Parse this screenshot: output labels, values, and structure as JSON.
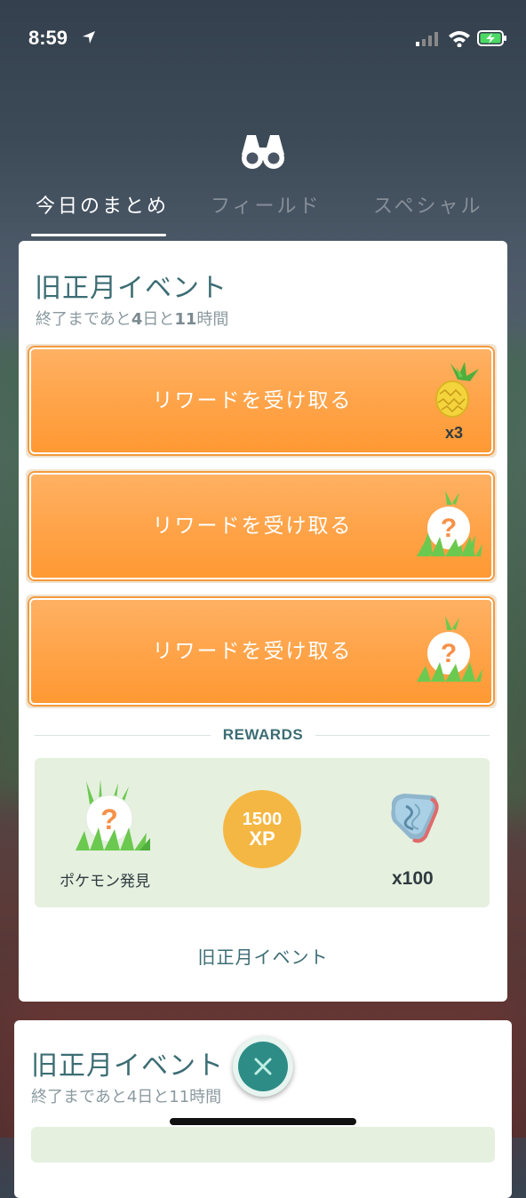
{
  "status_bar": {
    "time": "8:59"
  },
  "tabs": [
    {
      "label": "今日のまとめ",
      "active": true
    },
    {
      "label": "フィールド",
      "active": false
    },
    {
      "label": "スペシャル",
      "active": false
    }
  ],
  "event_card": {
    "title": "旧正月イベント",
    "remaining_prefix": "終了まであと",
    "remaining_days": "4",
    "remaining_mid": "日と",
    "remaining_hours": "11",
    "remaining_suffix": "時間",
    "claim_buttons": [
      {
        "label": "リワードを受け取る",
        "icon": "pinap-berry-icon",
        "quantity": "x3"
      },
      {
        "label": "リワードを受け取る",
        "icon": "pokemon-encounter-icon",
        "quantity": ""
      },
      {
        "label": "リワードを受け取る",
        "icon": "pokemon-encounter-icon",
        "quantity": ""
      }
    ],
    "rewards_header": "REWARDS",
    "rewards": {
      "encounter_label": "ポケモン発見",
      "xp_amount": "1500",
      "xp_unit": "XP",
      "candy_quantity": "x100"
    },
    "footer_label": "旧正月イベント"
  },
  "next_card": {
    "title": "旧正月イベント",
    "remaining": "終了まであと4日と11時間"
  },
  "colors": {
    "accent_teal": "#3c6d74",
    "button_orange": "#ffa54c",
    "rewards_bg": "#e5f0df",
    "xp_gold": "#f5b743"
  }
}
